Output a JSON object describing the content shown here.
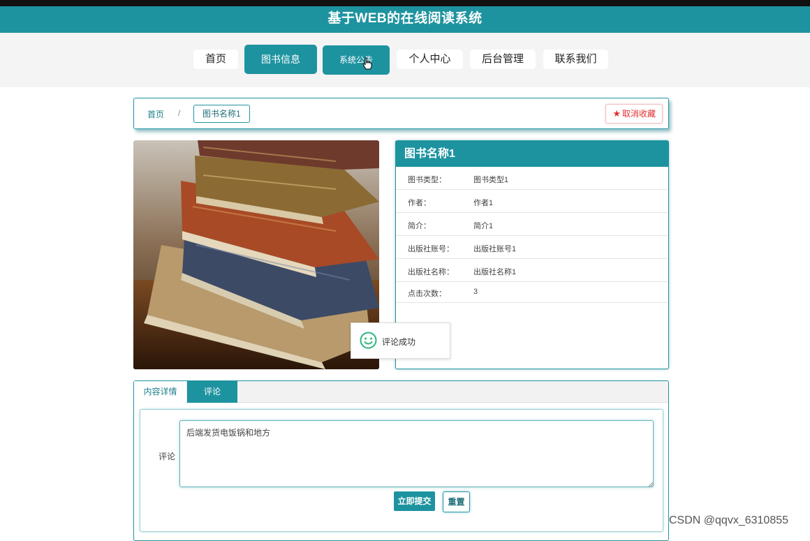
{
  "header": {
    "title": "基于WEB的在线阅读系统"
  },
  "nav": {
    "items": [
      {
        "label": "首页"
      },
      {
        "label": "图书信息"
      },
      {
        "label": "系统公告"
      },
      {
        "label": "个人中心"
      },
      {
        "label": "后台管理"
      },
      {
        "label": "联系我们"
      }
    ]
  },
  "breadcrumb": {
    "home": "首页",
    "separator": "/",
    "current": "图书名称1",
    "favorite_label": "取消收藏"
  },
  "book": {
    "name": "图书名称1",
    "fields": [
      {
        "key": "图书类型：",
        "value": "图书类型1"
      },
      {
        "key": "作者：",
        "value": "作者1"
      },
      {
        "key": "简介：",
        "value": "简介1"
      },
      {
        "key": "出版社账号：",
        "value": "出版社账号1"
      },
      {
        "key": "出版社名称：",
        "value": "出版社名称1"
      },
      {
        "key": "点击次数：",
        "value": "3"
      }
    ]
  },
  "toast": {
    "message": "评论成功"
  },
  "tabs": [
    {
      "label": "内容详情"
    },
    {
      "label": "评论"
    }
  ],
  "comment_form": {
    "label": "评论",
    "value": "后端发货电饭锅和地方",
    "submit_label": "立即提交",
    "reset_label": "重置"
  },
  "watermark": "CSDN @qqvx_6310855",
  "colors": {
    "accent": "#1e93a0",
    "favorite": "#e03030",
    "toast_icon": "#2cb57a"
  }
}
